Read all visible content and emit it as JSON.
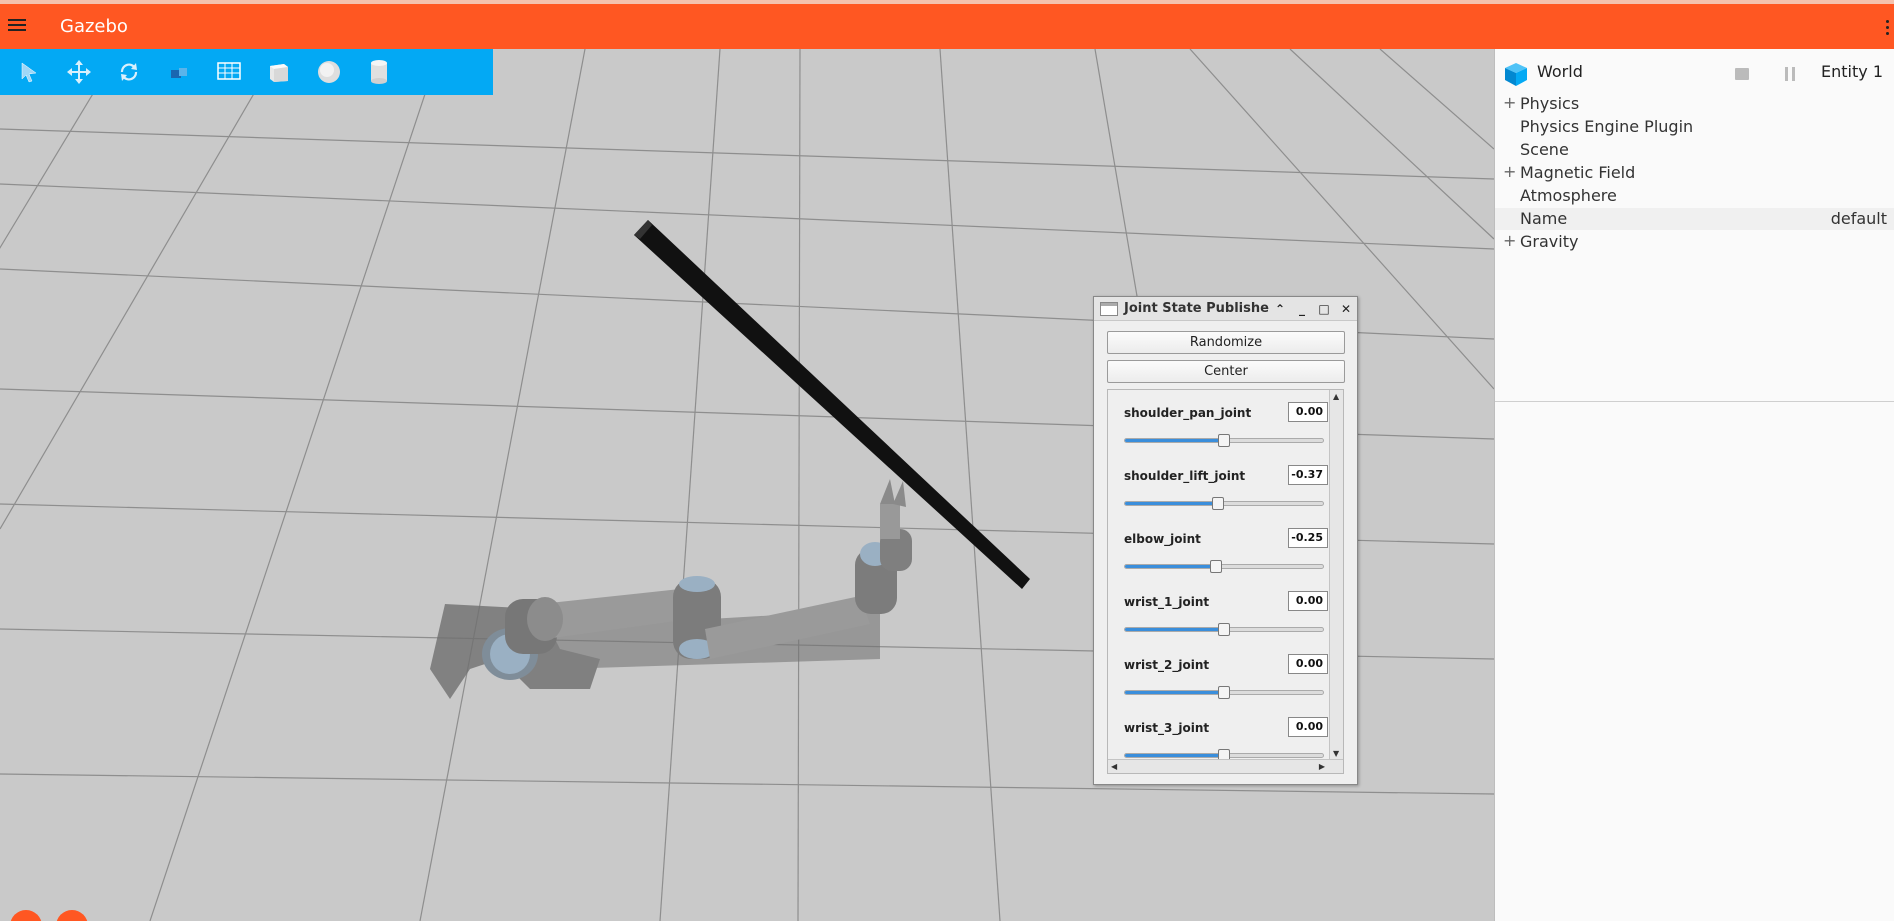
{
  "app": {
    "title": "Gazebo",
    "accent_color": "#ff5722",
    "toolbar_color": "#03a9f4"
  },
  "toolbar": {
    "tools": [
      {
        "name": "select-tool",
        "icon": "arrow-pointer-icon"
      },
      {
        "name": "translate-tool",
        "icon": "move-arrows-icon"
      },
      {
        "name": "rotate-tool",
        "icon": "rotate-icon"
      },
      {
        "name": "transform-tool",
        "icon": "snap-cube-icon"
      },
      {
        "name": "grid-tool",
        "icon": "grid-icon"
      },
      {
        "name": "box-shape",
        "icon": "cube-icon"
      },
      {
        "name": "sphere-shape",
        "icon": "sphere-icon"
      },
      {
        "name": "cylinder-shape",
        "icon": "cylinder-icon"
      }
    ]
  },
  "component_inspector": {
    "header_title": "World",
    "entity_label": "Entity 1",
    "rows": [
      {
        "label": "Physics",
        "expandable": true,
        "value": ""
      },
      {
        "label": "Physics Engine Plugin",
        "expandable": false,
        "value": ""
      },
      {
        "label": "Scene",
        "expandable": false,
        "value": ""
      },
      {
        "label": "Magnetic Field",
        "expandable": true,
        "value": ""
      },
      {
        "label": "Atmosphere",
        "expandable": false,
        "value": ""
      },
      {
        "label": "Name",
        "expandable": false,
        "value": "default"
      },
      {
        "label": "Gravity",
        "expandable": true,
        "value": ""
      }
    ]
  },
  "joint_state_publisher": {
    "window_title": "Joint State Publishe",
    "randomize_label": "Randomize",
    "center_label": "Center",
    "joints": [
      {
        "name": "shoulder_pan_joint",
        "value": "0.00",
        "fraction": 0.5
      },
      {
        "name": "shoulder_lift_joint",
        "value": "-0.37",
        "fraction": 0.47
      },
      {
        "name": "elbow_joint",
        "value": "-0.25",
        "fraction": 0.46
      },
      {
        "name": "wrist_1_joint",
        "value": "0.00",
        "fraction": 0.5
      },
      {
        "name": "wrist_2_joint",
        "value": "0.00",
        "fraction": 0.5
      },
      {
        "name": "wrist_3_joint",
        "value": "0.00",
        "fraction": 0.5
      }
    ]
  }
}
